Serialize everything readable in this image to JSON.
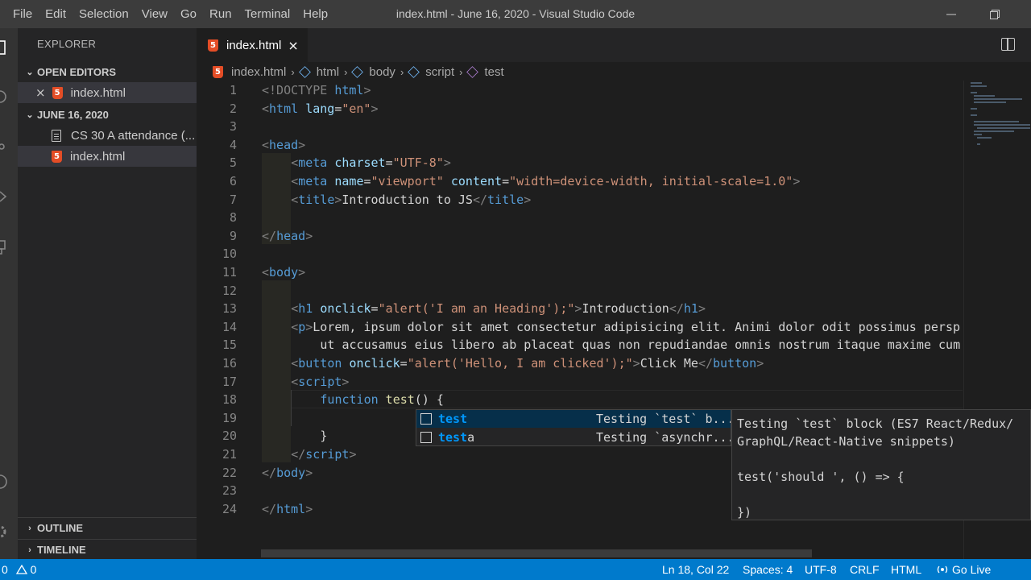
{
  "menu": [
    "File",
    "Edit",
    "Selection",
    "View",
    "Go",
    "Run",
    "Terminal",
    "Help"
  ],
  "window_title": "index.html - June 16, 2020 - Visual Studio Code",
  "sidebar": {
    "title": "EXPLORER",
    "open_editors_label": "OPEN EDITORS",
    "open_editor_file": "index.html",
    "folder_label": "JUNE 16, 2020",
    "folder_files": [
      "CS 30 A attendance (...",
      "index.html"
    ],
    "outline_label": "OUTLINE",
    "timeline_label": "TIMELINE"
  },
  "tab": {
    "label": "index.html"
  },
  "breadcrumb": [
    "index.html",
    "html",
    "body",
    "script",
    "test"
  ],
  "code": {
    "l1": [
      "<!DOCTYPE ",
      "html",
      ">"
    ],
    "l2": [
      "<",
      "html",
      " ",
      "lang",
      "=",
      "\"en\"",
      ">"
    ],
    "l4": [
      "<",
      "head",
      ">"
    ],
    "l5": [
      "<",
      "meta",
      " ",
      "charset",
      "=",
      "\"UTF-8\"",
      ">"
    ],
    "l6": [
      "<",
      "meta",
      " ",
      "name",
      "=",
      "\"viewport\"",
      " ",
      "content",
      "=",
      "\"width=device-width, initial-scale=1.0\"",
      ">"
    ],
    "l7": [
      "<",
      "title",
      ">",
      "Introduction to JS",
      "</",
      "title",
      ">"
    ],
    "l9": [
      "</",
      "head",
      ">"
    ],
    "l11": [
      "<",
      "body",
      ">"
    ],
    "l13": [
      "<",
      "h1",
      " ",
      "onclick",
      "=",
      "\"alert('I am an Heading');\"",
      ">",
      "Introduction",
      "</",
      "h1",
      ">"
    ],
    "l14": [
      "<",
      "p",
      ">",
      "Lorem, ipsum dolor sit amet consectetur adipisicing elit. Animi dolor odit possimus persp"
    ],
    "l15": [
      "ut accusamus eius libero ab placeat quas non repudiandae omnis nostrum itaque maxime cum"
    ],
    "l16": [
      "<",
      "button",
      " ",
      "onclick",
      "=",
      "\"alert('Hello, I am clicked');\"",
      ">",
      "Click Me",
      "</",
      "button",
      ">"
    ],
    "l17": [
      "<",
      "script",
      ">"
    ],
    "l18": [
      "function",
      " ",
      "test",
      "()",
      " {"
    ],
    "l20": [
      "}"
    ],
    "l21": [
      "</",
      "script",
      ">"
    ],
    "l22": [
      "</",
      "body",
      ">"
    ],
    "l24": [
      "</",
      "html",
      ">"
    ]
  },
  "line_numbers": [
    "1",
    "2",
    "3",
    "4",
    "5",
    "6",
    "7",
    "8",
    "9",
    "10",
    "11",
    "12",
    "13",
    "14",
    "15",
    "16",
    "17",
    "18",
    "19",
    "20",
    "21",
    "22",
    "23",
    "24"
  ],
  "suggest": [
    {
      "match": "test",
      "rest": "",
      "detail": "Testing `test` b..."
    },
    {
      "match": "test",
      "rest": "a",
      "detail": "Testing `asynchr..."
    }
  ],
  "doc": {
    "line1": "Testing `test` block (ES7 React/Redux/",
    "line2": "GraphQL/React-Native snippets)",
    "line3": "test('should ', () => {",
    "line4": "})"
  },
  "status": {
    "errors": "0",
    "warnings": "0",
    "position": "Ln 18, Col 22",
    "spaces": "Spaces: 4",
    "encoding": "UTF-8",
    "eol": "CRLF",
    "language": "HTML",
    "golive": "Go Live"
  },
  "colors": {
    "statusbar": "#007acc",
    "html5": "#e44d26",
    "tag": "#569cd6",
    "attr": "#9cdcfe",
    "string": "#ce9178"
  }
}
